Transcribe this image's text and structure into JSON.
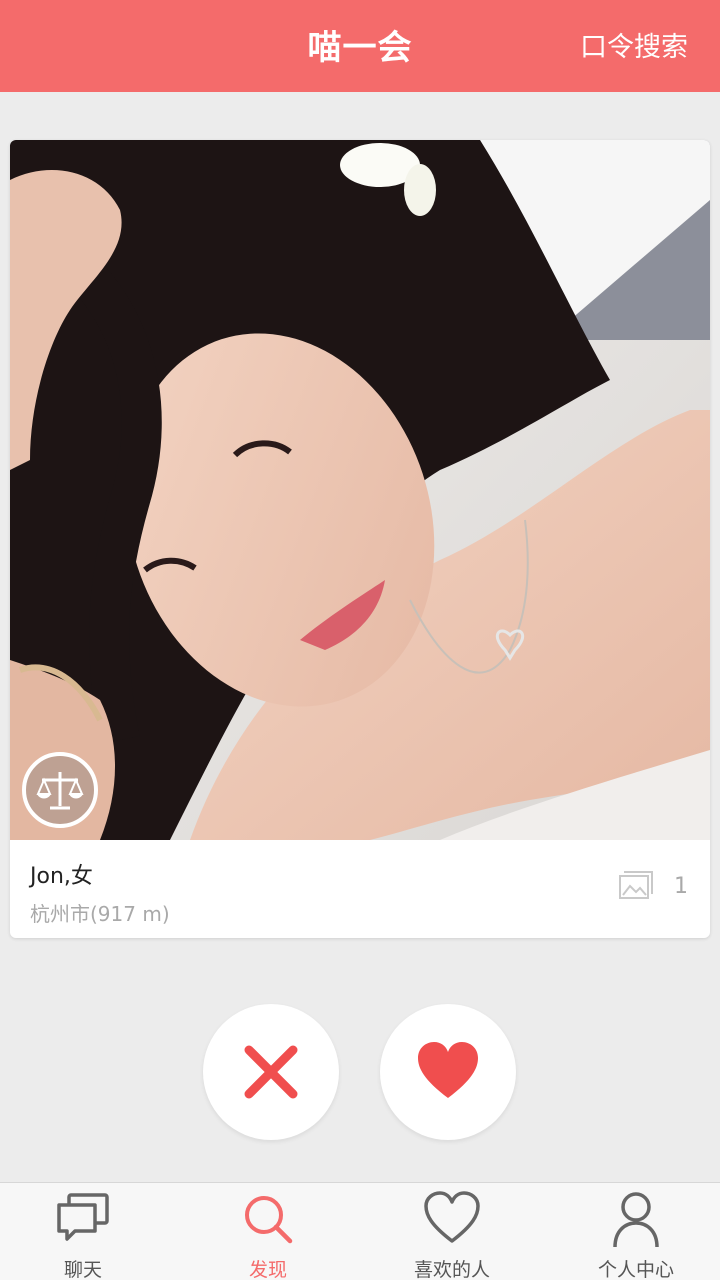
{
  "header": {
    "title": "喵一会",
    "search_label": "口令搜索"
  },
  "card": {
    "name": "Jon,女",
    "location": "杭州市(917 m)",
    "photo_count": "1",
    "zodiac_icon": "libra-scales-icon"
  },
  "actions": {
    "dislike_icon": "close-x-icon",
    "like_icon": "heart-icon"
  },
  "tabs": [
    {
      "label": "聊天",
      "icon": "chat-bubbles-icon",
      "active": false
    },
    {
      "label": "发现",
      "icon": "search-icon",
      "active": true
    },
    {
      "label": "喜欢的人",
      "icon": "heart-outline-icon",
      "active": false
    },
    {
      "label": "个人中心",
      "icon": "person-icon",
      "active": false
    }
  ],
  "colors": {
    "accent": "#f46b6b",
    "background": "#ececec",
    "muted_text": "#a9a9a9"
  }
}
